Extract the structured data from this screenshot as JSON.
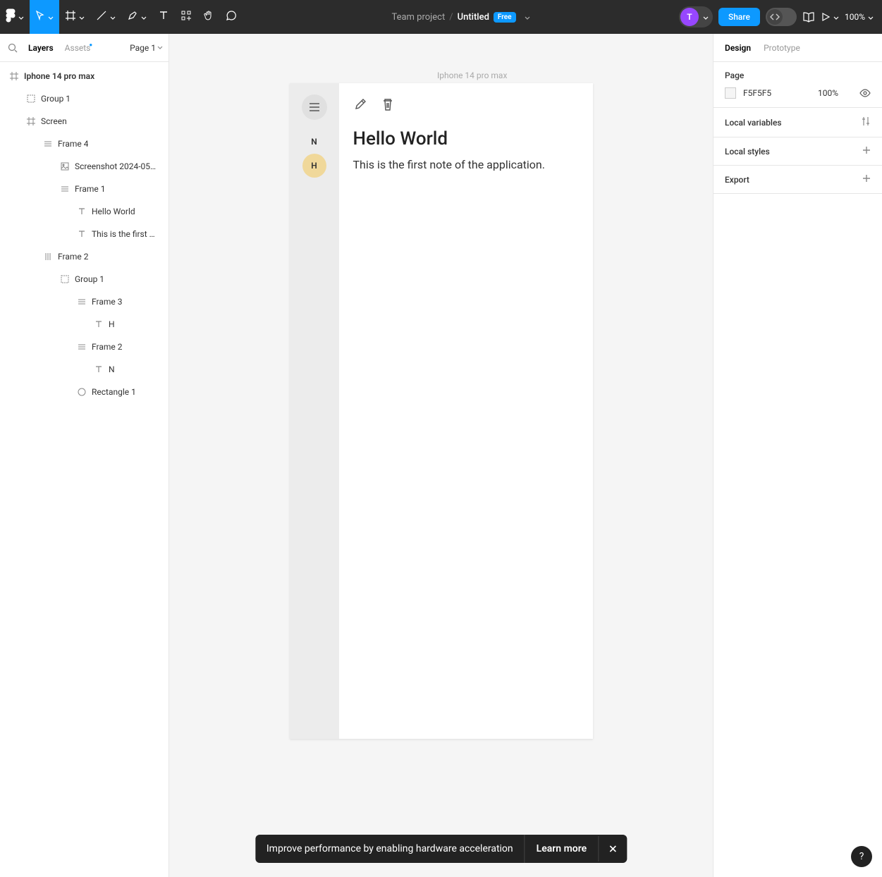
{
  "toolbar": {
    "breadcrumb_project": "Team project",
    "file_name": "Untitled",
    "free_badge": "Free",
    "avatar_letter": "T",
    "share_label": "Share",
    "zoom": "100%"
  },
  "left_panel": {
    "tabs": {
      "layers": "Layers",
      "assets": "Assets"
    },
    "page_selector": "Page 1",
    "layers": [
      {
        "indent": 12,
        "icon": "frame",
        "label": "Iphone 14 pro max",
        "bold": true
      },
      {
        "indent": 36,
        "icon": "group",
        "label": "Group 1"
      },
      {
        "indent": 36,
        "icon": "frame",
        "label": "Screen"
      },
      {
        "indent": 60,
        "icon": "layout",
        "label": "Frame 4"
      },
      {
        "indent": 84,
        "icon": "image",
        "label": "Screenshot 2024-05…"
      },
      {
        "indent": 84,
        "icon": "layout",
        "label": "Frame 1"
      },
      {
        "indent": 108,
        "icon": "text",
        "label": "Hello World"
      },
      {
        "indent": 108,
        "icon": "text",
        "label": "This is the first …"
      },
      {
        "indent": 60,
        "icon": "layouth",
        "label": "Frame 2"
      },
      {
        "indent": 84,
        "icon": "group",
        "label": "Group 1"
      },
      {
        "indent": 108,
        "icon": "layout",
        "label": "Frame 3"
      },
      {
        "indent": 132,
        "icon": "text",
        "label": "H"
      },
      {
        "indent": 108,
        "icon": "layout",
        "label": "Frame 2"
      },
      {
        "indent": 132,
        "icon": "text",
        "label": "N"
      },
      {
        "indent": 108,
        "icon": "ellipse",
        "label": "Rectangle 1"
      }
    ]
  },
  "canvas": {
    "frame_label": "Iphone 14 pro max",
    "sidebar_letters": [
      {
        "text": "N",
        "selected": false
      },
      {
        "text": "H",
        "selected": true
      }
    ],
    "note_title": "Hello World",
    "note_body": "This is the first note of the application."
  },
  "right_panel": {
    "tabs": {
      "design": "Design",
      "prototype": "Prototype"
    },
    "page_section": "Page",
    "color_hex": "F5F5F5",
    "color_opacity": "100%",
    "local_variables": "Local variables",
    "local_styles": "Local styles",
    "export": "Export"
  },
  "toast": {
    "message": "Improve performance by enabling hardware acceleration",
    "link": "Learn more"
  },
  "help_label": "?"
}
